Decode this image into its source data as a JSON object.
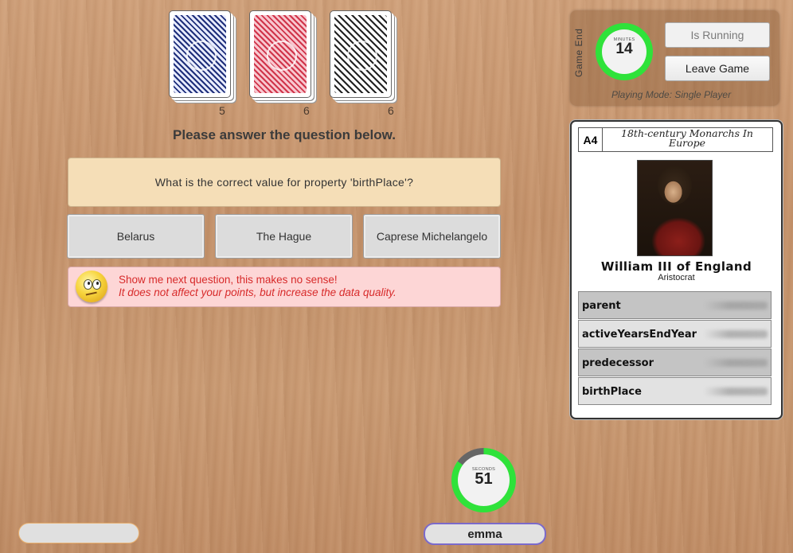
{
  "decks": [
    {
      "color": "blue",
      "count": "5"
    },
    {
      "color": "red",
      "count": "6"
    },
    {
      "color": "black",
      "count": "6"
    }
  ],
  "instruction": "Please answer the question below.",
  "question": "What is the correct value for property 'birthPlace'?",
  "answers": [
    "Belarus",
    "The Hague",
    "Caprese Michelangelo"
  ],
  "skip": {
    "line1": "Show me next question, this makes no sense!",
    "line2": "It does not affect your points, but increase the data quality."
  },
  "game_panel": {
    "game_end_label": "Game End",
    "minutes_unit": "MINUTES",
    "minutes_value": "14",
    "running_label": "Is Running",
    "leave_label": "Leave Game",
    "playing_mode": "Playing Mode: Single Player"
  },
  "card": {
    "id": "A4",
    "category": "18th-century Monarchs In Europe",
    "name": "William III of England",
    "subtitle": "Aristocrat",
    "properties": [
      "parent",
      "activeYearsEndYear",
      "predecessor",
      "birthPlace"
    ]
  },
  "timer": {
    "unit": "SECONDS",
    "value": "51",
    "progress_fraction": 0.85
  },
  "players": {
    "left": "",
    "current": "emma"
  },
  "colors": {
    "timer_green": "#2fe23a",
    "skip_text": "#d72a2a",
    "player_border": "#7b6acb"
  }
}
